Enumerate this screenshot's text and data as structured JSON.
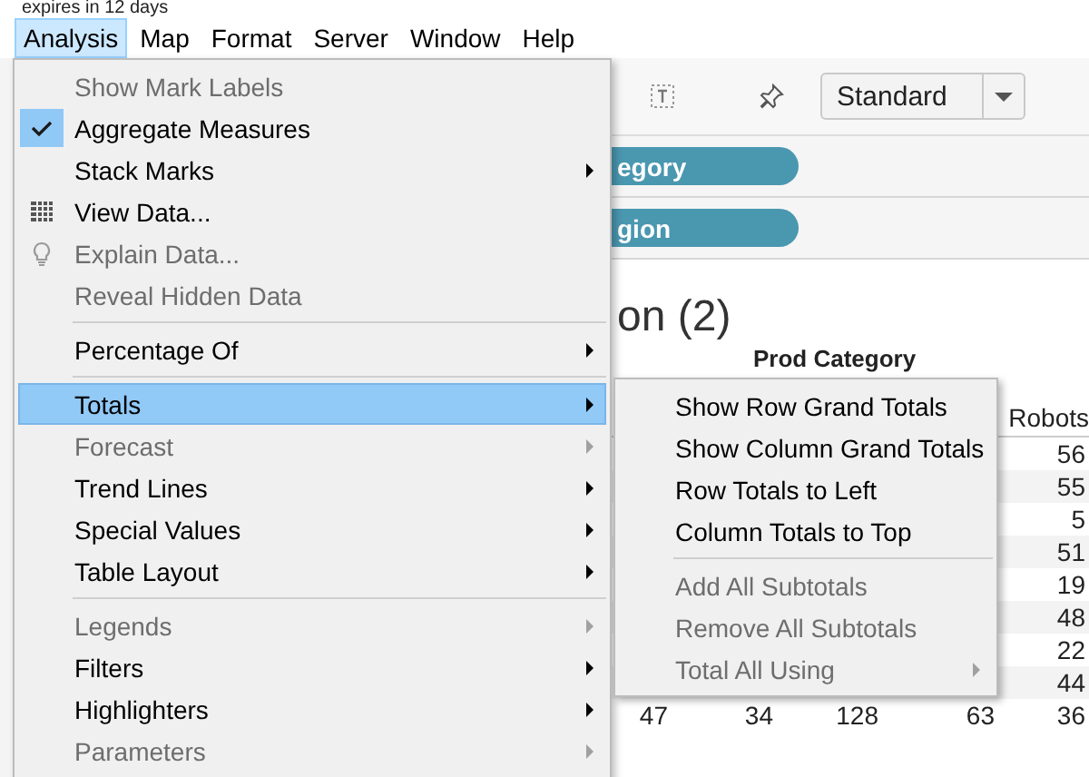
{
  "trial_notice": "expires in 12 days",
  "menubar": [
    {
      "label": "Analysis",
      "selected": true
    },
    {
      "label": "Map",
      "selected": false
    },
    {
      "label": "Format",
      "selected": false
    },
    {
      "label": "Server",
      "selected": false
    },
    {
      "label": "Window",
      "selected": false
    },
    {
      "label": "Help",
      "selected": false
    }
  ],
  "analysis_menu": [
    {
      "kind": "item",
      "label": "Show Mark Labels",
      "disabled": true,
      "checked": false,
      "selected": false,
      "submenu": false
    },
    {
      "kind": "item",
      "label": "Aggregate Measures",
      "disabled": false,
      "checked": true,
      "selected": false,
      "submenu": false
    },
    {
      "kind": "item",
      "label": "Stack Marks",
      "disabled": false,
      "checked": false,
      "selected": false,
      "submenu": true
    },
    {
      "kind": "tableitem",
      "label": "View Data...",
      "disabled": false,
      "checked": false,
      "selected": false,
      "submenu": false
    },
    {
      "kind": "bulbitem",
      "label": "Explain Data...",
      "disabled": true,
      "checked": false,
      "selected": false,
      "submenu": false
    },
    {
      "kind": "item",
      "label": "Reveal Hidden Data",
      "disabled": true,
      "checked": false,
      "selected": false,
      "submenu": false
    },
    {
      "kind": "separator"
    },
    {
      "kind": "item",
      "label": "Percentage Of",
      "disabled": false,
      "checked": false,
      "selected": false,
      "submenu": true
    },
    {
      "kind": "separator"
    },
    {
      "kind": "item",
      "label": "Totals",
      "disabled": false,
      "checked": false,
      "selected": true,
      "submenu": true
    },
    {
      "kind": "item",
      "label": "Forecast",
      "disabled": true,
      "checked": false,
      "selected": false,
      "submenu": true
    },
    {
      "kind": "item",
      "label": "Trend Lines",
      "disabled": false,
      "checked": false,
      "selected": false,
      "submenu": true
    },
    {
      "kind": "item",
      "label": "Special Values",
      "disabled": false,
      "checked": false,
      "selected": false,
      "submenu": true
    },
    {
      "kind": "item",
      "label": "Table Layout",
      "disabled": false,
      "checked": false,
      "selected": false,
      "submenu": true
    },
    {
      "kind": "separator"
    },
    {
      "kind": "item",
      "label": "Legends",
      "disabled": true,
      "checked": false,
      "selected": false,
      "submenu": true
    },
    {
      "kind": "item",
      "label": "Filters",
      "disabled": false,
      "checked": false,
      "selected": false,
      "submenu": true
    },
    {
      "kind": "item",
      "label": "Highlighters",
      "disabled": false,
      "checked": false,
      "selected": false,
      "submenu": true
    },
    {
      "kind": "item",
      "label": "Parameters",
      "disabled": true,
      "checked": false,
      "selected": false,
      "submenu": true
    }
  ],
  "totals_submenu": [
    {
      "kind": "item",
      "label": "Show Row Grand Totals",
      "disabled": false,
      "submenu": false
    },
    {
      "kind": "item",
      "label": "Show Column Grand Totals",
      "disabled": false,
      "submenu": false
    },
    {
      "kind": "item",
      "label": "Row Totals to Left",
      "disabled": false,
      "submenu": false
    },
    {
      "kind": "item",
      "label": "Column Totals to Top",
      "disabled": false,
      "submenu": false
    },
    {
      "kind": "separator"
    },
    {
      "kind": "item",
      "label": "Add All Subtotals",
      "disabled": true,
      "submenu": false
    },
    {
      "kind": "item",
      "label": "Remove All Subtotals",
      "disabled": true,
      "submenu": false
    },
    {
      "kind": "item",
      "label": "Total All Using",
      "disabled": true,
      "submenu": true
    }
  ],
  "toolbar": {
    "fit_dropdown": "Standard"
  },
  "shelves": [
    {
      "pill": "egory"
    },
    {
      "pill": "gion"
    }
  ],
  "view": {
    "title": "on (2)",
    "column_header": "Prod Category",
    "table": {
      "columns": [
        "Robots"
      ],
      "rows": [
        {
          "cells": [
            "56"
          ]
        },
        {
          "cells": [
            "55"
          ]
        },
        {
          "cells": [
            "5"
          ]
        },
        {
          "cells": [
            "51"
          ]
        },
        {
          "cells": [
            "19"
          ]
        },
        {
          "cells": [
            "48"
          ]
        },
        {
          "cells": [
            "22"
          ]
        },
        {
          "cells": [
            "44"
          ]
        },
        {
          "cells": [
            "47",
            "34",
            "128",
            "63",
            "36"
          ]
        }
      ]
    }
  }
}
